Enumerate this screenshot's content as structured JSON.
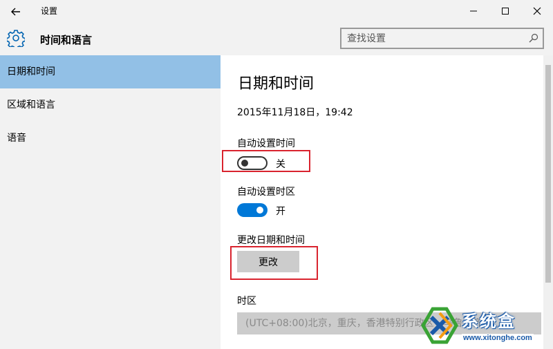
{
  "window": {
    "title": "设置"
  },
  "header": {
    "section_title": "时间和语言",
    "search_placeholder": "查找设置"
  },
  "sidebar": {
    "items": [
      {
        "label": "日期和时间",
        "active": true
      },
      {
        "label": "区域和语言",
        "active": false
      },
      {
        "label": "语音",
        "active": false
      }
    ]
  },
  "main": {
    "heading": "日期和时间",
    "current_datetime": "2015年11月18日，19:42",
    "auto_time": {
      "label": "自动设置时间",
      "state_text": "关",
      "on": false
    },
    "auto_timezone": {
      "label": "自动设置时区",
      "state_text": "开",
      "on": true
    },
    "change_datetime": {
      "label": "更改日期和时间",
      "button_label": "更改"
    },
    "timezone": {
      "label": "时区",
      "value": "(UTC+08:00)北京，重庆，香港特别行政区，乌鲁木齐"
    }
  },
  "watermark": {
    "brand": "系统盒",
    "url": "www.xitonghe.com"
  },
  "colors": {
    "accent": "#0078d7",
    "sidebar_active": "#92c0e6",
    "highlight": "#d9232e",
    "button_bg": "#cccccc"
  }
}
